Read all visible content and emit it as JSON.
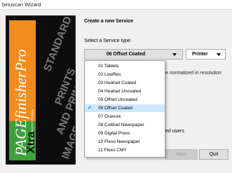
{
  "window": {
    "title": "binuscan Wizard"
  },
  "banner": {
    "brand": "PAGEfinisherPro",
    "brand_tagline": "Image Enhancement & Proofing",
    "brand_suffix": "Xtra",
    "words": [
      "STANDARD",
      "PRINTS",
      "AND PRINT",
      "IMAGES",
      "PRINT"
    ]
  },
  "heading": "Create a new Service",
  "service_type_label": "Select a Service type:",
  "service_combo": {
    "value": "06 Offset Coated"
  },
  "printer_combo": {
    "value": "Printer"
  },
  "note": "e normalized in resolution",
  "users_text": "ed users",
  "buttons": {
    "next": "Next",
    "quit": "Quit"
  },
  "dropdown": {
    "items": [
      "01 Tablets",
      "02 LowRes",
      "03 Heatset Coated",
      "04 Heatset Uncoated",
      "05 Offset Uncoated",
      "06 Offset Coated",
      "07 Gravure",
      "08 Coldset Newspaper",
      "09 Digital Press",
      "10 Flexo Newspaper",
      "11 Flexo CMY"
    ],
    "selected_index": 5
  },
  "colors": {
    "banner_orange": "#f28c1c",
    "banner_green": "#3ea03a",
    "selection": "#cce8ff",
    "check": "#0078d7"
  }
}
